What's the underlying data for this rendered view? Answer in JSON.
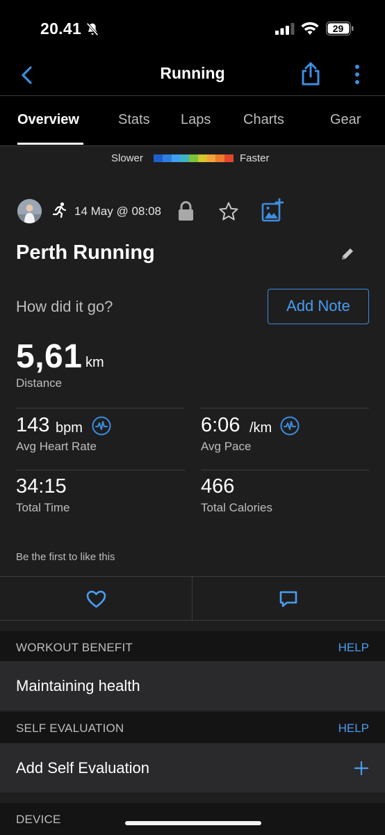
{
  "status_bar": {
    "time": "20.41",
    "battery": "29"
  },
  "nav": {
    "title": "Running"
  },
  "tabs": [
    {
      "label": "Overview",
      "active": true
    },
    {
      "label": "Stats"
    },
    {
      "label": "Laps"
    },
    {
      "label": "Charts"
    },
    {
      "label": "Gear"
    }
  ],
  "pace_legend": {
    "slower_label": "Slower",
    "faster_label": "Faster",
    "colors": [
      "#1f5fc9",
      "#2d7fe0",
      "#3ea0f0",
      "#3fb4c4",
      "#7cc43c",
      "#d4c62c",
      "#f2a43a",
      "#f07a2c",
      "#e2472c"
    ]
  },
  "activity": {
    "date": "14 May @ 08:08",
    "title": "Perth Running",
    "prompt": "How did it go?",
    "add_note_label": "Add Note"
  },
  "distance": {
    "value": "5,61",
    "unit": "km",
    "label": "Distance"
  },
  "stats": {
    "hr": {
      "value": "143",
      "unit": "bpm",
      "label": "Avg Heart Rate"
    },
    "pace": {
      "value": "6:06",
      "unit": "/km",
      "label": "Avg Pace"
    },
    "time": {
      "value": "34:15",
      "label": "Total Time"
    },
    "calories": {
      "value": "466",
      "label": "Total Calories"
    }
  },
  "social": {
    "like_text": "Be the first to like this"
  },
  "sections": {
    "workout_benefit": {
      "title": "WORKOUT BENEFIT",
      "help": "HELP",
      "value": "Maintaining health"
    },
    "self_evaluation": {
      "title": "SELF EVALUATION",
      "help": "HELP",
      "value": "Add Self Evaluation"
    },
    "device": {
      "title": "DEVICE"
    }
  },
  "colors": {
    "accent": "#4a9cf0",
    "panel": "#1e1e1f",
    "row": "#2a2a2c"
  }
}
